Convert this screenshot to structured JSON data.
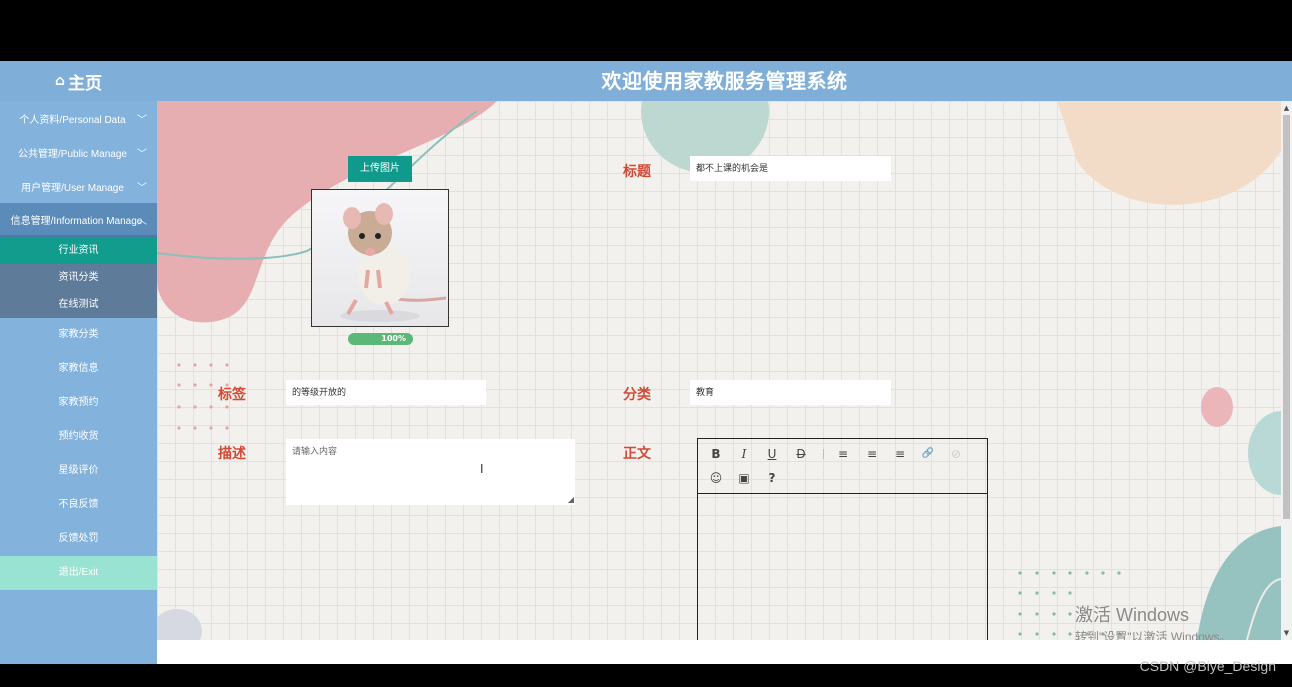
{
  "header": {
    "home_icon": "home-icon",
    "home_label": "主页",
    "title": "欢迎使用家教服务管理系统"
  },
  "sidebar": {
    "groups": [
      {
        "label": "个人资料/Personal Data",
        "chevron": "chevron-down-icon"
      },
      {
        "label": "公共管理/Public Manage",
        "chevron": "chevron-down-icon"
      },
      {
        "label": "用户管理/User Manage",
        "chevron": "chevron-down-icon"
      },
      {
        "label": "信息管理/Information Manage",
        "chevron": "chevron-up-icon"
      }
    ],
    "sub_items": [
      "行业资讯",
      "资讯分类",
      "在线测试"
    ],
    "items": [
      "家教分类",
      "家教信息",
      "家教预约",
      "预约收货",
      "星级评价",
      "不良反馈",
      "反馈处罚"
    ],
    "exit": "退出/Exit"
  },
  "form": {
    "upload_button": "上传图片",
    "progress": "100%",
    "progress_value": 100,
    "title_label": "标题",
    "title_value": "都不上课的机会是",
    "tag_label": "标签",
    "tag_value": "的等级开放的",
    "category_label": "分类",
    "category_value": "教育",
    "desc_label": "描述",
    "desc_placeholder": "请输入内容",
    "body_label": "正文"
  },
  "editor_toolbar": [
    "B",
    "I",
    "U",
    "D",
    "≡",
    "≡",
    "≡",
    "🔗",
    "⊘",
    "☺",
    "▣",
    "?"
  ],
  "watermarks": {
    "windows_line1": "激活 Windows",
    "windows_line2": "转到\"设置\"以激活 Windows。",
    "csdn": "CSDN @Biye_Design"
  },
  "colors": {
    "header": "#7fafd9",
    "sidebar": "#83b2dc",
    "active_sub": "#119c8e",
    "exit": "#99e3d3",
    "label": "#d24a36",
    "upload_button": "#0f9a8c",
    "progress": "#5cb877"
  }
}
